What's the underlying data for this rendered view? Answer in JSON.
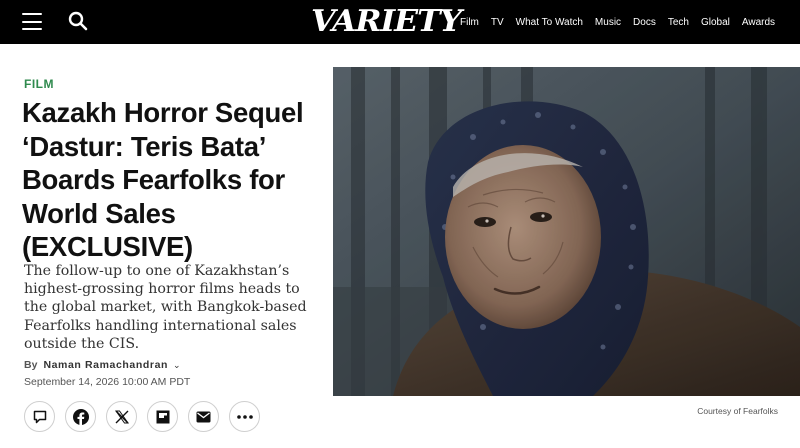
{
  "header": {
    "logo_text": "VARIETY",
    "nav": [
      "Film",
      "TV",
      "What To Watch",
      "Music",
      "Docs",
      "Tech",
      "Global",
      "Awards"
    ],
    "menu_icon": "hamburger-menu-icon",
    "search_icon": "search-icon"
  },
  "article": {
    "section": "FILM",
    "headline": "Kazakh Horror Sequel ‘Dastur: Teris Bata’ Boards Fearfolks for World Sales (EXCLUSIVE)",
    "dek": "The follow-up to one of Kazakhstan’s highest-grossing horror films heads to the global market, with Bangkok-based Fearfolks handling international sales outside the CIS.",
    "byline_prefix": "By",
    "author": "Naman Ramachandran",
    "date": "September 14, 2026 10:00 AM PDT",
    "share_icons": [
      "comment-icon",
      "facebook-icon",
      "x-icon",
      "flipboard-icon",
      "email-icon",
      "more-icon"
    ],
    "image_credit": "Courtesy of Fearfolks"
  },
  "colors": {
    "topbar": "#000000",
    "section": "#2f8a4e",
    "headline": "#111111"
  }
}
